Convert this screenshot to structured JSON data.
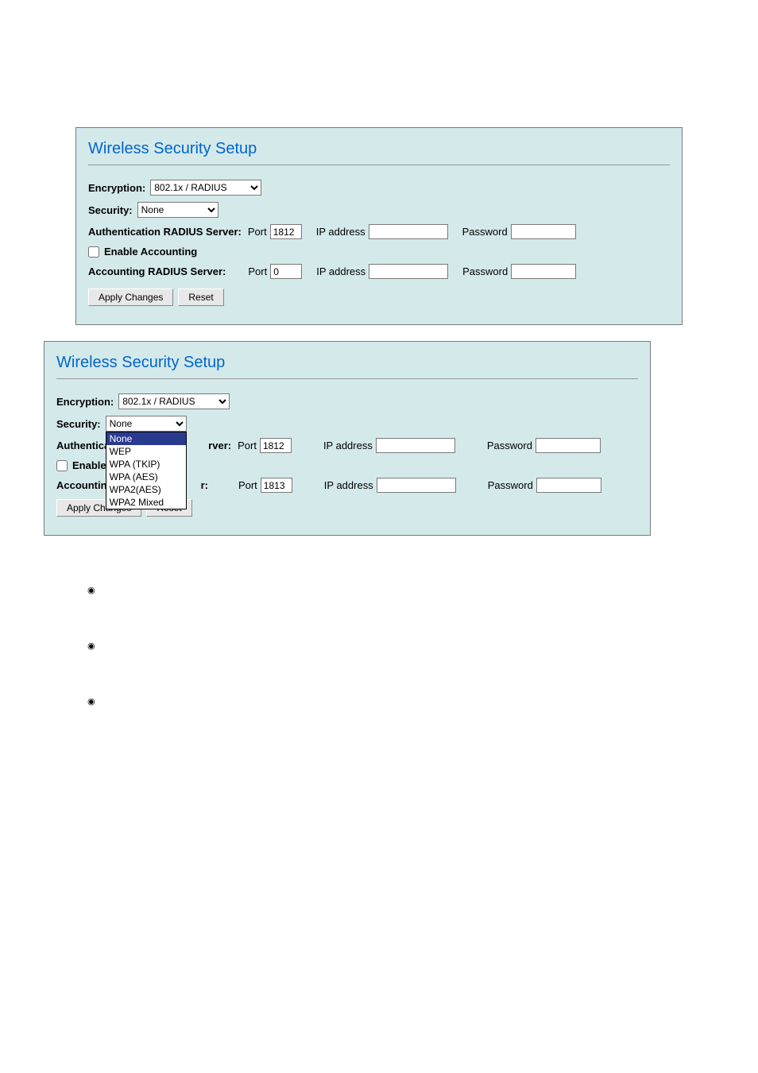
{
  "panel1": {
    "title": "Wireless Security Setup",
    "encryption_label": "Encryption:",
    "encryption_value": "802.1x / RADIUS",
    "security_label": "Security:",
    "security_value": "None",
    "auth_label": "Authentication RADIUS Server:",
    "port_label": "Port",
    "auth_port": "1812",
    "ip_label": "IP address",
    "auth_ip": "",
    "pw_label": "Password",
    "auth_pw": "",
    "enable_acct_label": "Enable Accounting",
    "acct_label": "Accounting RADIUS Server:",
    "acct_port": "0",
    "acct_ip": "",
    "acct_pw": "",
    "apply_btn": "Apply Changes",
    "reset_btn": "Reset"
  },
  "panel2": {
    "title": "Wireless Security Setup",
    "encryption_label": "Encryption:",
    "encryption_value": "802.1x / RADIUS",
    "security_label": "Security:",
    "security_value": "None",
    "options": {
      "o0": "None",
      "o1": "WEP",
      "o2": "WPA (TKIP)",
      "o3": "WPA (AES)",
      "o4": "WPA2(AES)",
      "o5": "WPA2 Mixed"
    },
    "auth_prefix": "Authentica",
    "auth_suffix": "rver:",
    "port_label": "Port",
    "auth_port": "1812",
    "ip_label": "IP address",
    "auth_ip": "",
    "pw_label": "Password",
    "auth_pw": "",
    "enable_prefix": "Enable",
    "acct_prefix": "Accountin",
    "acct_suffix": "r:",
    "acct_port": "1813",
    "acct_ip": "",
    "acct_pw": "",
    "apply_btn": "Apply Changes",
    "reset_btn": "Reset"
  }
}
